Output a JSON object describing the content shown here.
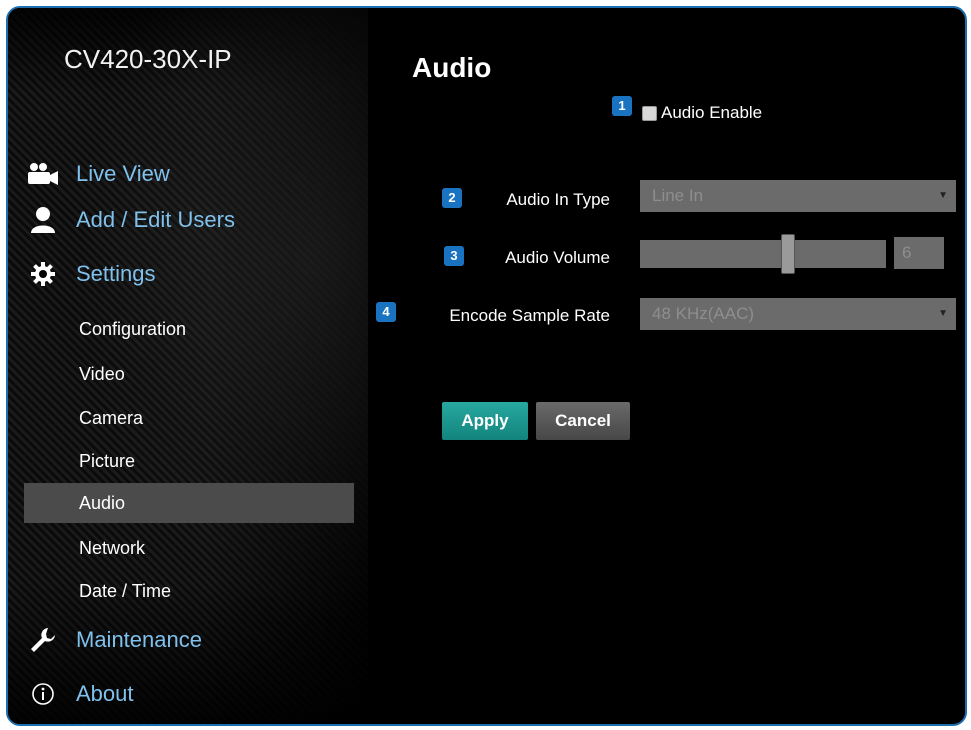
{
  "device": {
    "model": "CV420-30X-IP"
  },
  "sidebar": {
    "main_items": [
      {
        "label": "Live View",
        "icon": "camera-users-icon"
      },
      {
        "label": "Add / Edit Users",
        "icon": "user-icon"
      },
      {
        "label": "Settings",
        "icon": "gear-icon"
      },
      {
        "label": "Maintenance",
        "icon": "wrench-icon"
      },
      {
        "label": "About",
        "icon": "info-icon"
      }
    ],
    "sub_items": [
      {
        "label": "Configuration"
      },
      {
        "label": "Video"
      },
      {
        "label": "Camera"
      },
      {
        "label": "Picture"
      },
      {
        "label": "Audio",
        "active": true
      },
      {
        "label": "Network"
      },
      {
        "label": "Date / Time"
      }
    ]
  },
  "main": {
    "title": "Audio",
    "badges": [
      "1",
      "2",
      "3",
      "4"
    ],
    "audio_enable": {
      "label": "Audio Enable",
      "checked": false
    },
    "audio_in_type": {
      "label": "Audio In Type",
      "value": "Line In"
    },
    "audio_volume": {
      "label": "Audio Volume",
      "value": "6",
      "level": 0.6
    },
    "encode_sample_rate": {
      "label": "Encode Sample Rate",
      "value": "48 KHz(AAC)"
    },
    "buttons": {
      "apply": "Apply",
      "cancel": "Cancel"
    }
  },
  "colors": {
    "accent": "#7fc1ec",
    "badge": "#1a73c0",
    "apply": "#19968f",
    "frame_border": "#1e6fb0",
    "active_item": "#4b4b4b"
  }
}
